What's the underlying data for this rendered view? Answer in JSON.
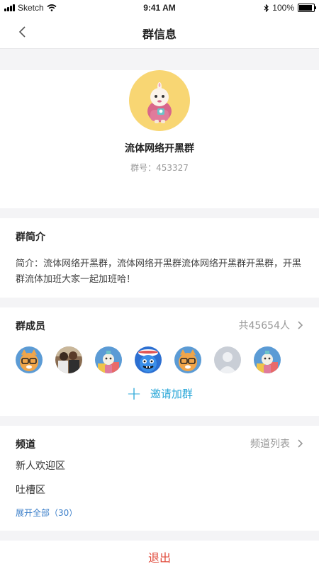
{
  "status_bar": {
    "carrier": "Sketch",
    "time": "9:41 AM",
    "battery": "100%"
  },
  "nav": {
    "title": "群信息"
  },
  "profile": {
    "name": "流体网络开黑群",
    "id_label": "群号：453327"
  },
  "intro": {
    "title": "群简介",
    "text": "简介：流体网络开黑群，流体网络开黑群流体网络开黑群开黑群，开黑群流体加班大家一起加班哈！"
  },
  "members": {
    "title": "群成员",
    "count": "共45654人",
    "invite_label": "邀请加群",
    "avatars": [
      "cat-avatar",
      "group-photo-avatar",
      "character-avatar",
      "blue-monster-avatar",
      "cat-avatar",
      "default-avatar",
      "character-avatar"
    ]
  },
  "channels": {
    "title": "频道",
    "list_label": "频道列表",
    "items": [
      "新人欢迎区",
      "吐槽区"
    ],
    "expand_label": "展开全部（30）"
  },
  "exit_label": "退出",
  "colors": {
    "accent": "#2aa7d8",
    "danger": "#e0493a",
    "link": "#3a7ec9",
    "avatar_bg": "#f8d673"
  }
}
